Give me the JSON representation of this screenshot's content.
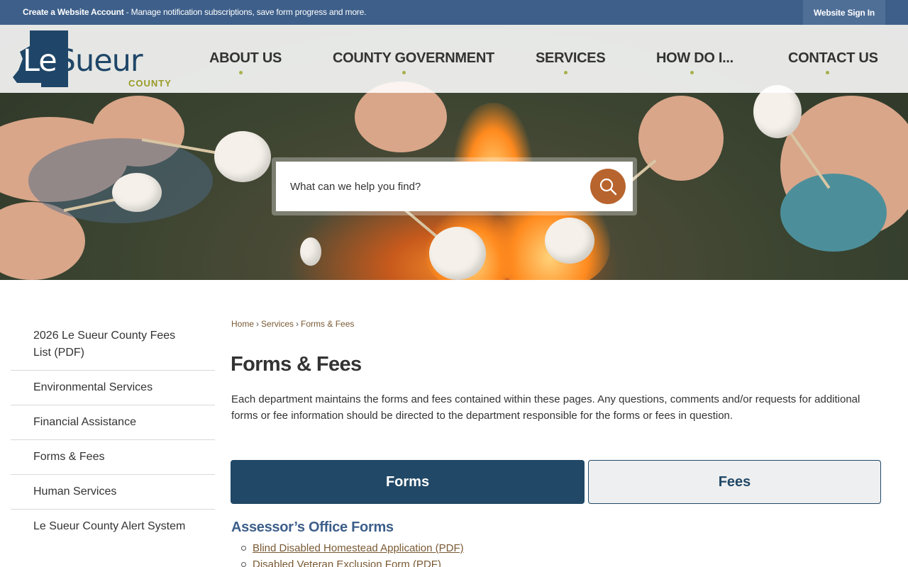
{
  "topbar": {
    "message_bold": "Create a Website Account",
    "message_rest": " - Manage notification subscriptions, save form progress and more.",
    "signin_label": "Website Sign In"
  },
  "logo": {
    "le": "Le",
    "sueur": "Sueur",
    "county": "COUNTY"
  },
  "nav": {
    "items": [
      "ABOUT US",
      "COUNTY GOVERNMENT",
      "SERVICES",
      "HOW DO I...",
      "CONTACT US"
    ]
  },
  "search": {
    "placeholder": "What can we help you find?"
  },
  "sidebar": {
    "items": [
      "2026 Le Sueur County Fees List (PDF)",
      "Environmental Services",
      "Financial Assistance",
      "Forms & Fees",
      "Human Services",
      "Le Sueur County Alert System"
    ]
  },
  "breadcrumb": {
    "items": [
      "Home",
      "Services",
      "Forms & Fees"
    ],
    "separator": "›"
  },
  "page": {
    "title": "Forms & Fees",
    "intro": "Each department maintains the forms and fees contained within these pages. Any questions, comments and/or requests for additional forms or fee information should be directed to the department responsible for the forms or fees in question."
  },
  "tabs": {
    "forms": "Forms",
    "fees": "Fees",
    "active": "Forms"
  },
  "section": {
    "title": "Assessor’s Office Forms",
    "links": [
      "Blind Disabled Homestead Application (PDF)",
      "Disabled Veteran Exclusion Form (PDF)"
    ]
  },
  "colors": {
    "topbar": "#3d5f8a",
    "nav_dot": "#a7b04a",
    "search_button": "#b8642e",
    "tab_active": "#214866",
    "link": "#7a5a34",
    "section_title": "#3d5f8a"
  },
  "icons": {
    "search": "search-icon"
  }
}
